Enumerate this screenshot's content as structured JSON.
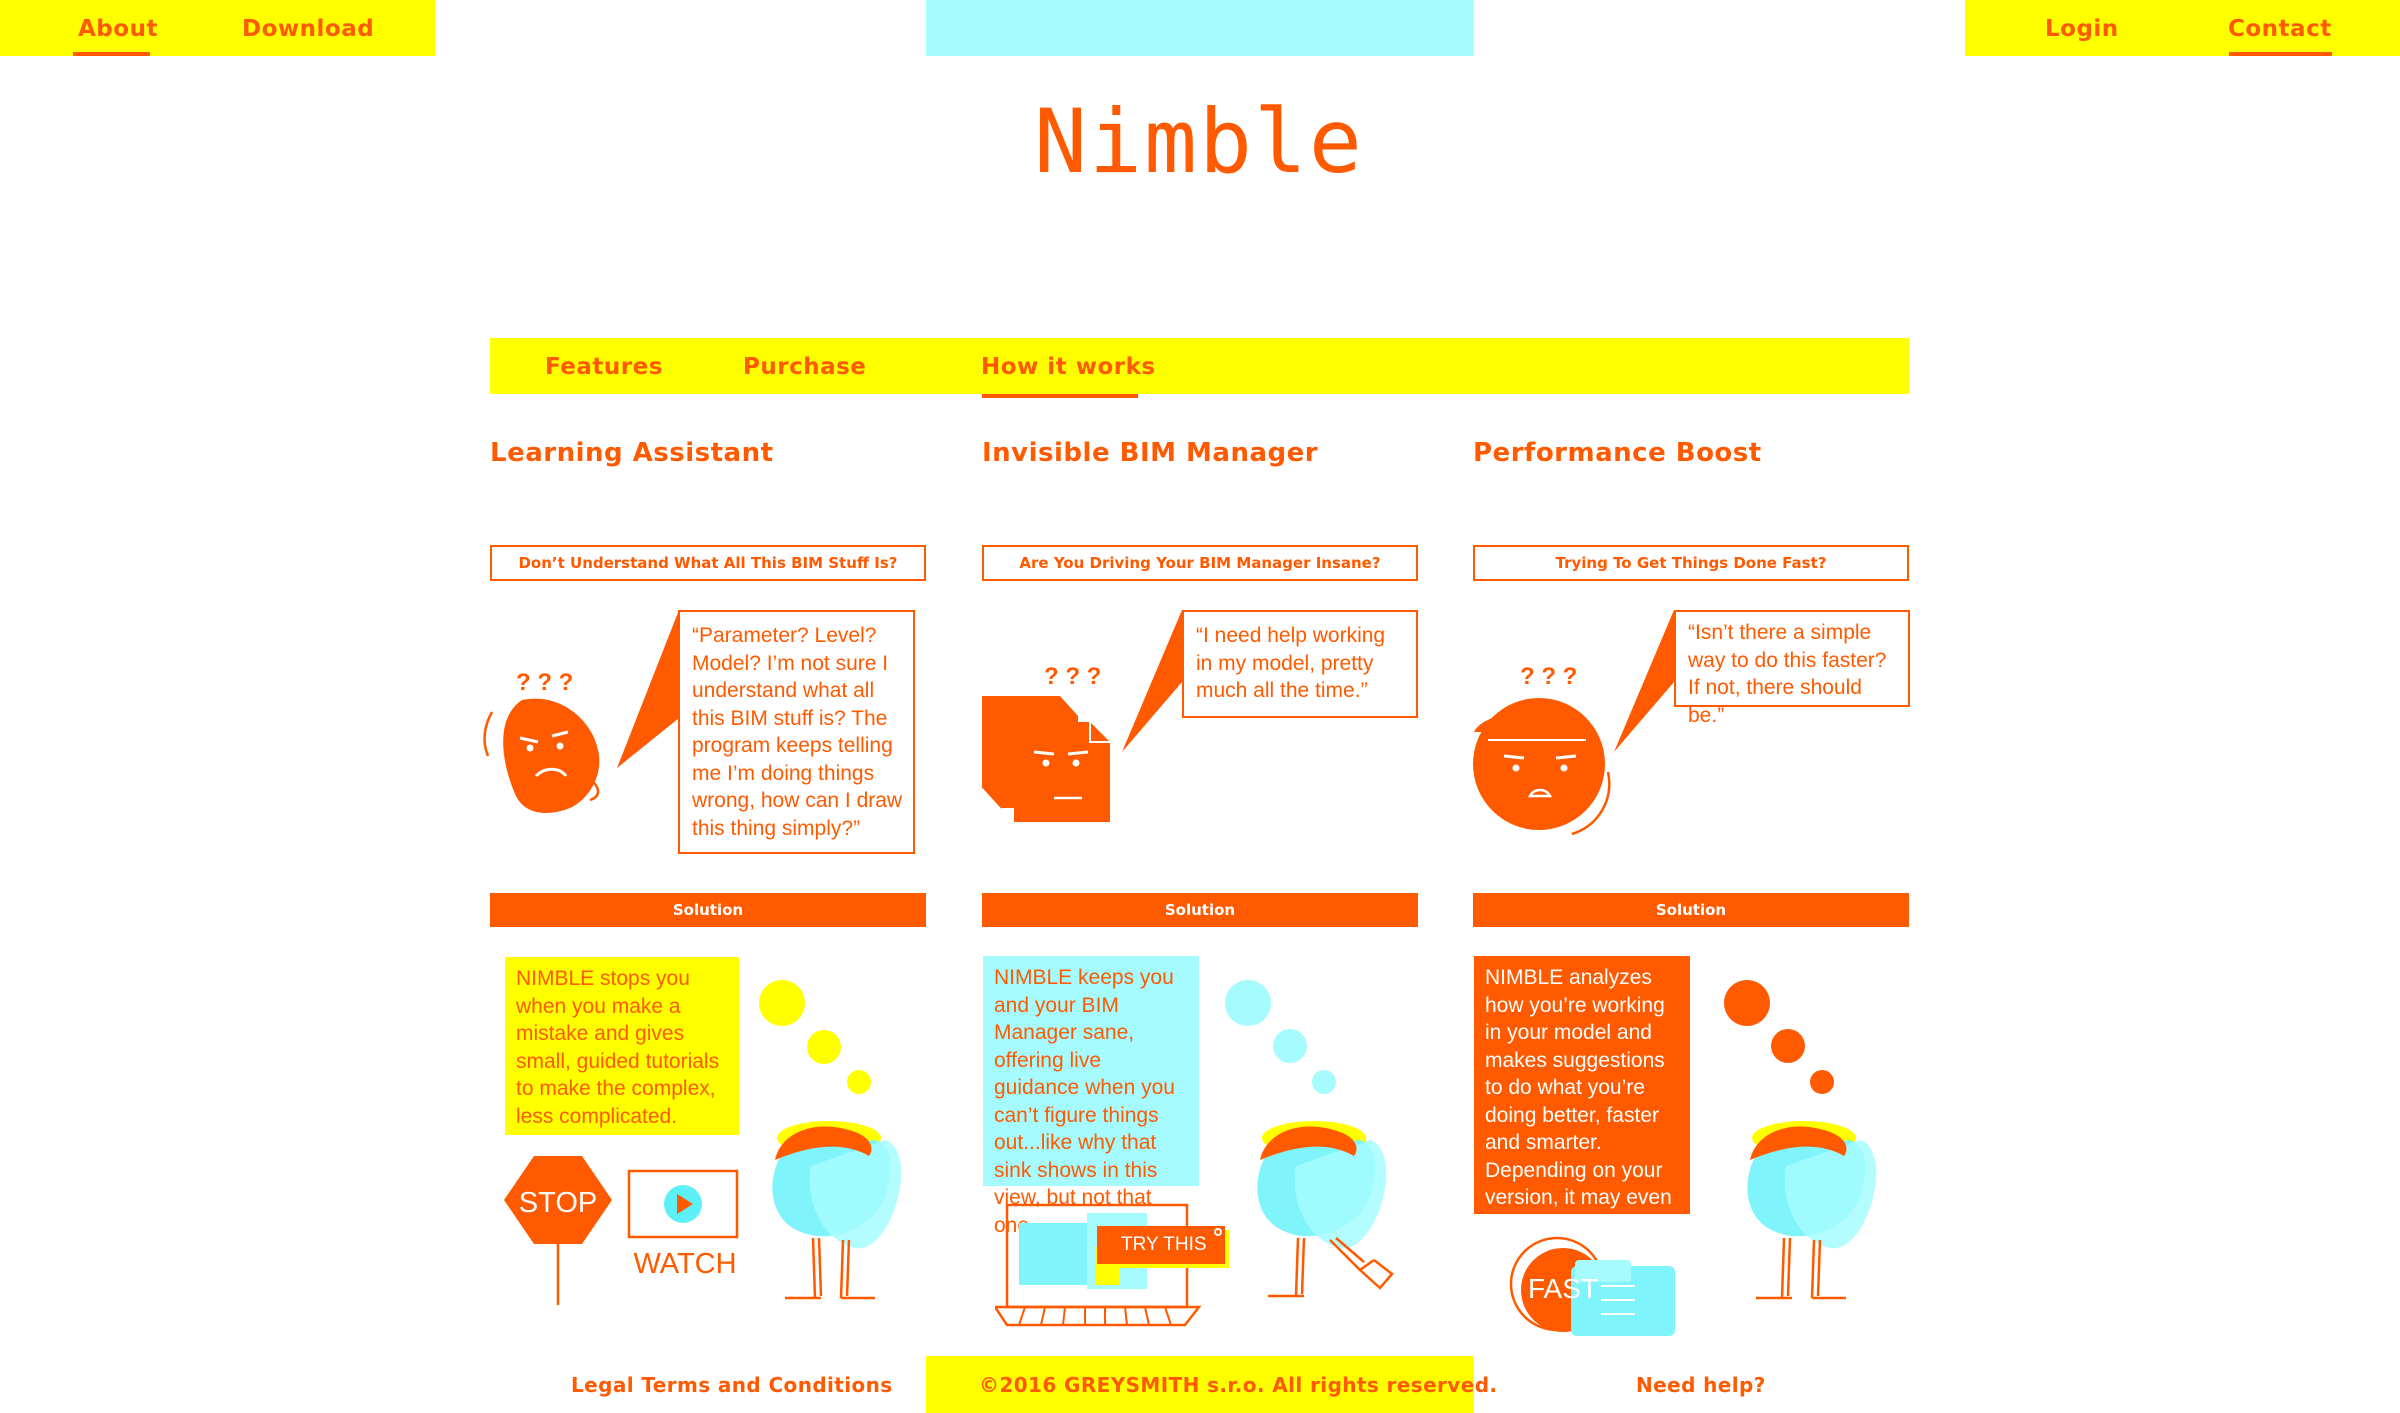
{
  "top_nav": {
    "left": [
      "About",
      "Download"
    ],
    "right": [
      "Login",
      "Contact"
    ]
  },
  "logo": "Nimble",
  "sub_nav": {
    "tabs": [
      "Features",
      "Purchase",
      "How it works"
    ],
    "active": "How it works"
  },
  "columns": [
    {
      "title": "Learning Assistant",
      "question": "Don’t Understand What All This BIM Stuff Is?",
      "quote": "“Parameter? Level? Model? I’m not sure I understand what all this BIM stuff is? The program keeps telling me I’m doing things wrong, how can I draw this thing simply?”",
      "solution_label": "Solution",
      "solution": "NIMBLE stops you when you make a mistake and gives small, guided tutorials to make the complex, less complicated.",
      "stop_label": "STOP",
      "watch_label": "WATCH"
    },
    {
      "title": "Invisible BIM Manager",
      "question": "Are You Driving Your BIM Manager Insane?",
      "quote": "“I need help working in my model, pretty much all the time.”",
      "solution_label": "Solution",
      "solution": "NIMBLE keeps you and your BIM Manager sane, offering live guidance when you can’t figure things out...like why that sink shows in this view, but not that one.",
      "try_label": "TRY THIS"
    },
    {
      "title": "Performance Boost",
      "question": "Trying To Get Things Done Fast?",
      "quote": "“Isn’t there a simple way to do this faster? If not, there should be.”",
      "solution_label": "Solution",
      "solution": "NIMBLE analyzes how you’re working in your model and makes suggestions to do what you’re doing better, faster and smarter. Depending on your version, it may even do it for you.",
      "fast_label": "FAST"
    }
  ],
  "question_marks": "? ? ?",
  "footer": {
    "legal": "Legal Terms and Conditions",
    "copyright": "©2016 GREYSMITH s.r.o. All rights reserved.",
    "help": "Need help?"
  },
  "colors": {
    "accent": "#ff5a00",
    "yellow": "#ffff00",
    "cyan": "#a6fbff"
  }
}
